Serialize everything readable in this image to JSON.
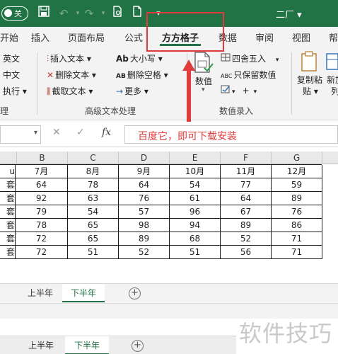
{
  "titlebar": {
    "autosave_label": "关",
    "doc_title": "二厂 ▾",
    "accent": "#217346"
  },
  "tabs": [
    "开始",
    "插入",
    "页面布局",
    "公式",
    "方方格子",
    "数据",
    "审阅",
    "视图",
    "帮"
  ],
  "ribbon": {
    "left_cut": [
      "英文",
      "中文",
      "执行 ▾"
    ],
    "advanced_text": {
      "items_col1": [
        "插入文本 ▾",
        "删除文本 ▾",
        "截取文本 ▾"
      ],
      "items_col2": [
        "大小写 ▾",
        "删除空格 ▾",
        "更多 ▾"
      ],
      "icons_col2": [
        "Ab",
        "AB",
        "→"
      ],
      "group_label": "高级文本处理"
    },
    "left_group_label": "理",
    "numeric": {
      "big_label": "数值",
      "round_label": "四舍五入",
      "keep_label": "只保留数值",
      "abc": "ABC",
      "plus": "+",
      "group_label": "数值录入"
    },
    "clipboard": {
      "copy_label_1": "复制粘",
      "copy_label_2": "贴 ▾",
      "new_label_1": "新加",
      "new_label_2": "列"
    }
  },
  "formula": {
    "cancel": "✕",
    "confirm": "✓",
    "fx": "fx",
    "content": "百度它，即可下载安装",
    "annotation_color": "#e03c3c"
  },
  "grid": {
    "columns": [
      "B",
      "C",
      "D",
      "E",
      "F",
      "G"
    ],
    "header_row": [
      "7月",
      "8月",
      "9月",
      "10月",
      "11月",
      "12月"
    ],
    "row_labels": [
      "u",
      "套",
      "套",
      "套",
      "套",
      "套"
    ],
    "rows": [
      [
        64,
        78,
        64,
        54,
        77,
        59
      ],
      [
        92,
        63,
        76,
        61,
        64,
        89
      ],
      [
        79,
        54,
        57,
        96,
        67,
        76
      ],
      [
        78,
        65,
        98,
        94,
        89,
        86
      ],
      [
        72,
        65,
        89,
        68,
        52,
        71
      ],
      [
        72,
        51,
        52,
        51,
        56,
        71
      ]
    ]
  },
  "sheets": [
    "上半年",
    "下半年"
  ],
  "sheets_active": "下半年",
  "sheets_add": "+",
  "watermark": "软件技巧"
}
